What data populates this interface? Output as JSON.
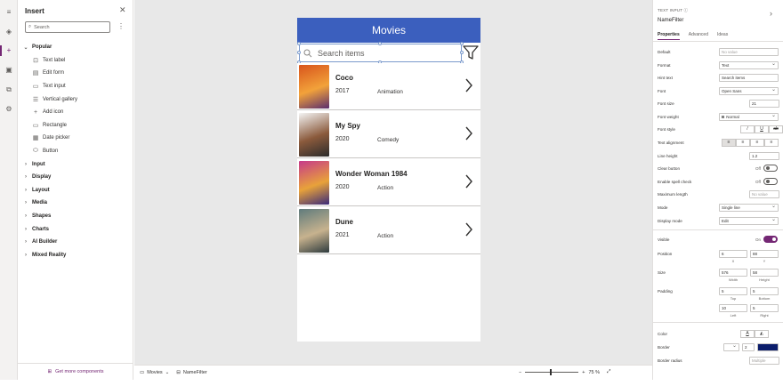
{
  "insert_panel": {
    "title": "Insert",
    "search_placeholder": "Search",
    "popular": {
      "label": "Popular",
      "items": [
        {
          "label": "Text label",
          "icon": "text-label-icon"
        },
        {
          "label": "Edit form",
          "icon": "edit-form-icon"
        },
        {
          "label": "Text input",
          "icon": "text-input-icon"
        },
        {
          "label": "Vertical gallery",
          "icon": "gallery-icon"
        },
        {
          "label": "Add icon",
          "icon": "plus-icon"
        },
        {
          "label": "Rectangle",
          "icon": "rectangle-icon"
        },
        {
          "label": "Date picker",
          "icon": "calendar-icon"
        },
        {
          "label": "Button",
          "icon": "button-icon"
        }
      ]
    },
    "categories": [
      "Input",
      "Display",
      "Layout",
      "Media",
      "Shapes",
      "Charts",
      "AI Builder",
      "Mixed Reality"
    ],
    "footer": "Get more components"
  },
  "app": {
    "header_title": "Movies",
    "search_placeholder": "Search items",
    "movies": [
      {
        "title": "Coco",
        "year": "2017",
        "genre": "Animation",
        "poster_colors": [
          "#d8541c",
          "#f2a23a",
          "#5a2d6e"
        ]
      },
      {
        "title": "My Spy",
        "year": "2020",
        "genre": "Comedy",
        "poster_colors": [
          "#f4f4f4",
          "#8b5a3c",
          "#2b2b2b"
        ]
      },
      {
        "title": "Wonder Woman 1984",
        "year": "2020",
        "genre": "Action",
        "poster_colors": [
          "#c63a8a",
          "#e8a23a",
          "#3a2a7a"
        ]
      },
      {
        "title": "Dune",
        "year": "2021",
        "genre": "Action",
        "poster_colors": [
          "#5f7b7c",
          "#c7b28e",
          "#2d3a3d"
        ]
      }
    ]
  },
  "bottom_bar": {
    "screen": "Movies",
    "control": "NameFilter",
    "zoom_minus": "−",
    "zoom_plus": "+",
    "zoom_level": "75 %"
  },
  "properties": {
    "kind": "TEXT INPUT",
    "name": "NameFilter",
    "tabs": [
      "Properties",
      "Advanced",
      "Ideas"
    ],
    "rows": {
      "default": {
        "label": "Default",
        "value": "No value"
      },
      "format": {
        "label": "Format",
        "value": "Text"
      },
      "hint": {
        "label": "Hint text",
        "value": "Search items"
      },
      "font": {
        "label": "Font",
        "value": "Open Sans"
      },
      "font_size": {
        "label": "Font size",
        "value": "21"
      },
      "font_weight": {
        "label": "Font weight",
        "value": "Normal"
      },
      "font_style": {
        "label": "Font style"
      },
      "text_align": {
        "label": "Text alignment"
      },
      "line_height": {
        "label": "Line height",
        "value": "1.2"
      },
      "clear_button": {
        "label": "Clear button",
        "state": "Off"
      },
      "spell_check": {
        "label": "Enable spell check",
        "state": "Off"
      },
      "max_length": {
        "label": "Maximum length",
        "value": "No value"
      },
      "mode": {
        "label": "Mode",
        "value": "Single line"
      },
      "display_mode": {
        "label": "Display mode",
        "value": "Edit"
      },
      "visible": {
        "label": "Visible",
        "state": "On"
      },
      "position": {
        "label": "Position",
        "x": "6",
        "y": "88",
        "x_label": "X",
        "y_label": "Y"
      },
      "size": {
        "label": "Size",
        "w": "576",
        "h": "58",
        "w_label": "Width",
        "h_label": "Height"
      },
      "padding": {
        "label": "Padding",
        "top": "5",
        "bottom": "5",
        "left": "10",
        "right": "5",
        "top_label": "Top",
        "bottom_label": "Bottom",
        "left_label": "Left",
        "right_label": "Right"
      },
      "color": {
        "label": "Color"
      },
      "border": {
        "label": "Border",
        "value": "2",
        "swatch": "#0b1d6b"
      },
      "border_radius": {
        "label": "Border radius",
        "value": "Multiple"
      }
    }
  },
  "colors": {
    "accent": "#742774",
    "header": "#3b5fbe"
  }
}
